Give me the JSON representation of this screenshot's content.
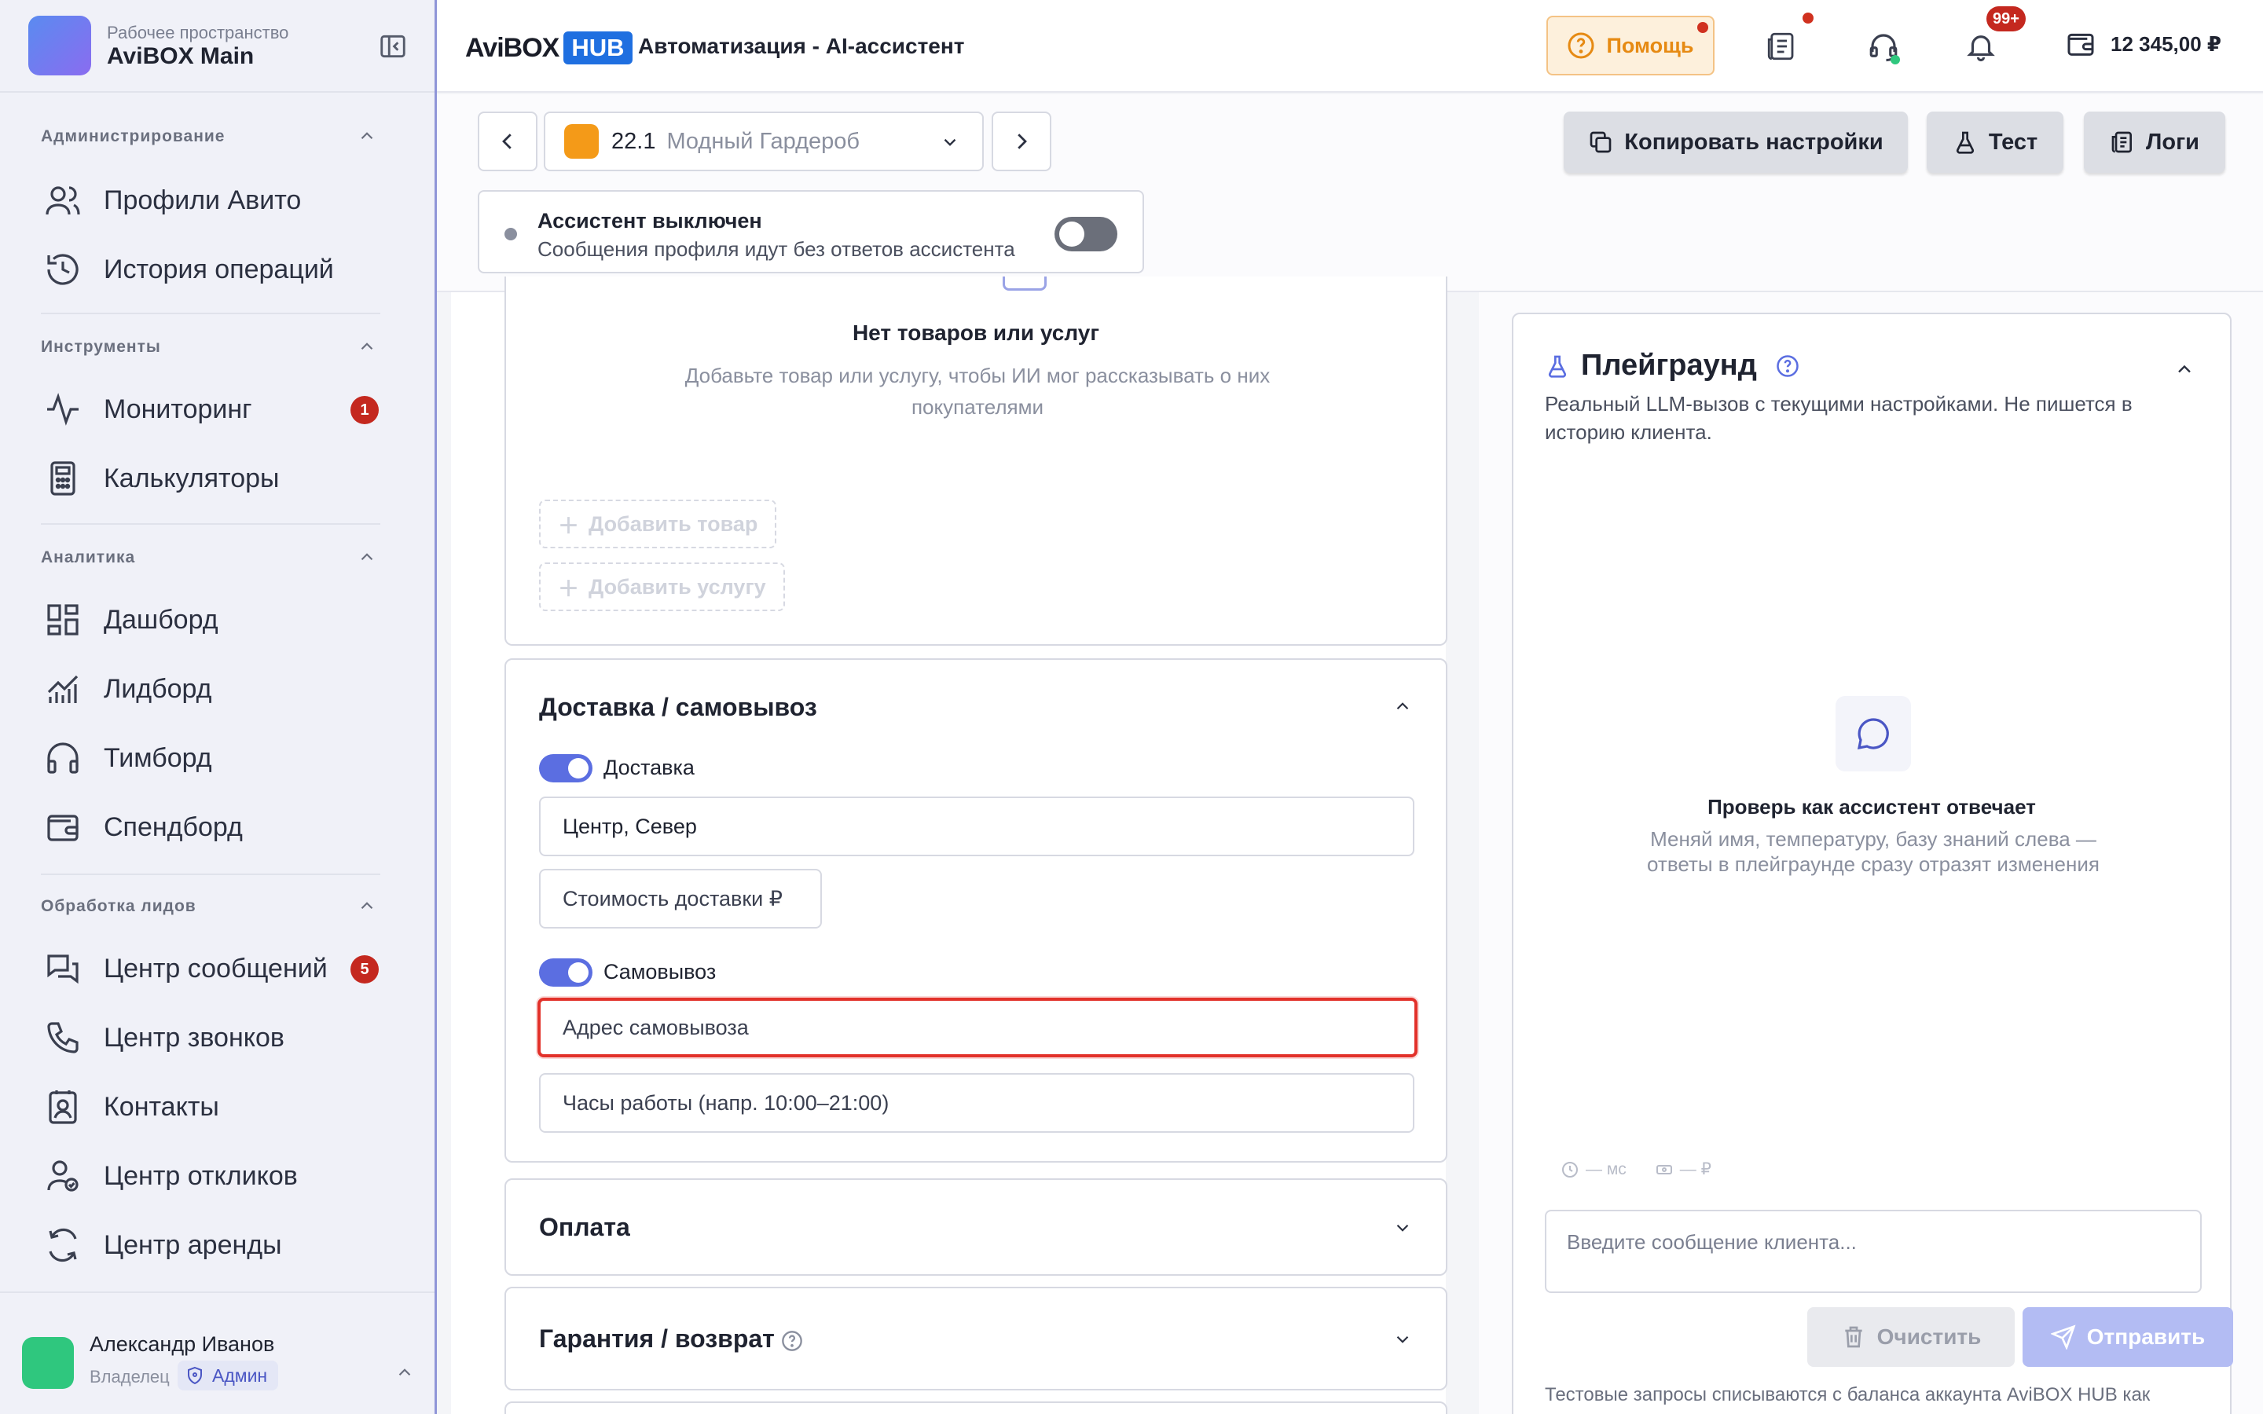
{
  "workspace": {
    "subtitle": "Рабочее пространство",
    "name": "AviBOX Main"
  },
  "sidebar": {
    "sections": [
      {
        "title": "Администрирование",
        "items": [
          {
            "label": "Профили Авито",
            "icon": "users-icon"
          },
          {
            "label": "История операций",
            "icon": "history-icon"
          }
        ]
      },
      {
        "title": "Инструменты",
        "items": [
          {
            "label": "Мониторинг",
            "icon": "activity-icon",
            "badge": "1"
          },
          {
            "label": "Калькуляторы",
            "icon": "calculator-icon"
          }
        ]
      },
      {
        "title": "Аналитика",
        "items": [
          {
            "label": "Дашборд",
            "icon": "dashboard-icon"
          },
          {
            "label": "Лидборд",
            "icon": "chart-icon"
          },
          {
            "label": "Тимборд",
            "icon": "headphones-icon"
          },
          {
            "label": "Спендборд",
            "icon": "wallet-icon"
          }
        ]
      },
      {
        "title": "Обработка лидов",
        "items": [
          {
            "label": "Центр сообщений",
            "icon": "messages-icon",
            "badge": "5"
          },
          {
            "label": "Центр звонков",
            "icon": "phone-icon"
          },
          {
            "label": "Контакты",
            "icon": "contacts-icon"
          },
          {
            "label": "Центр откликов",
            "icon": "user-check-icon"
          },
          {
            "label": "Центр аренды",
            "icon": "refresh-icon"
          }
        ]
      }
    ]
  },
  "user": {
    "name": "Александр Иванов",
    "role": "Владелец",
    "badge": "Админ"
  },
  "header": {
    "brand_a": "AviBOX",
    "brand_b": "HUB",
    "title": "Автоматизация - AI-ассистент",
    "help_label": "Помощь",
    "notifications_badge": "99+",
    "balance": "12 345,00 ₽"
  },
  "toolbar": {
    "profile_number": "22.1",
    "profile_name": "Модный Гардероб",
    "copy_label": "Копировать настройки",
    "test_label": "Тест",
    "logs_label": "Логи"
  },
  "assistant": {
    "status_title": "Ассистент выключен",
    "status_subtitle": "Сообщения профиля идут без ответов ассистента"
  },
  "products": {
    "empty_title": "Нет товаров или услуг",
    "empty_subtitle": "Добавьте товар или услугу, чтобы ИИ мог рассказывать о них покупателями",
    "add_product": "Добавить товар",
    "add_service": "Добавить услугу"
  },
  "delivery": {
    "title": "Доставка / самовывоз",
    "delivery_label": "Доставка",
    "delivery_zone_value": "Центр, Север",
    "delivery_cost_placeholder": "Стоимость доставки ₽",
    "pickup_label": "Самовывоз",
    "pickup_address_placeholder": "Адрес самовывоза",
    "hours_placeholder": "Часы работы (напр. 10:00–21:00)"
  },
  "payment": {
    "title": "Оплата"
  },
  "warranty": {
    "title": "Гарантия / возврат"
  },
  "playground": {
    "title": "Плейграунд",
    "description": "Реальный LLM-вызов с текущими настройками. Не пишется в историю клиента.",
    "empty_title": "Проверь как ассистент отвечает",
    "empty_subtitle": "Меняй имя, температуру, базу знаний слева — ответы в плейграунде сразу отразят изменения",
    "latency": "— мс",
    "cost": "— ₽",
    "input_placeholder": "Введите сообщение клиента...",
    "clear_label": "Очистить",
    "send_label": "Отправить",
    "footer": "Тестовые запросы списываются с баланса аккаунта AviBOX HUB как"
  }
}
